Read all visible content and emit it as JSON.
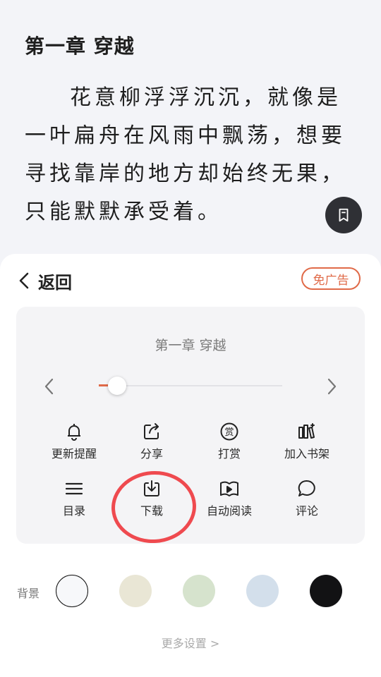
{
  "reader": {
    "chapter_title": "第一章 穿越",
    "paragraph": "花意柳浮浮沉沉，就像是一叶扁舟在风雨中飘荡，想要寻找靠岸的地方却始终无果，只能默默承受着。"
  },
  "panel": {
    "back_label": "返回",
    "ad_free_label": "免广告",
    "chapter_name": "第一章 穿越",
    "progress": 0.1,
    "actions_row1": [
      {
        "label": "更新提醒",
        "icon": "bell-icon"
      },
      {
        "label": "分享",
        "icon": "share-icon"
      },
      {
        "label": "打赏",
        "icon": "reward-icon"
      },
      {
        "label": "加入书架",
        "icon": "bookshelf-icon"
      }
    ],
    "actions_row2": [
      {
        "label": "目录",
        "icon": "menu-icon"
      },
      {
        "label": "下载",
        "icon": "download-icon"
      },
      {
        "label": "自动阅读",
        "icon": "auto-read-icon"
      },
      {
        "label": "评论",
        "icon": "comment-icon"
      }
    ],
    "reward_glyph": "赏",
    "background_label": "背景",
    "background_colors": [
      "#f7f8fa",
      "#e9e6d5",
      "#d6e3cd",
      "#d3dfeb",
      "#121214"
    ],
    "more_settings": "更多设置 >"
  },
  "colors": {
    "accent": "#e06a48",
    "highlight": "#ef4a4f"
  }
}
